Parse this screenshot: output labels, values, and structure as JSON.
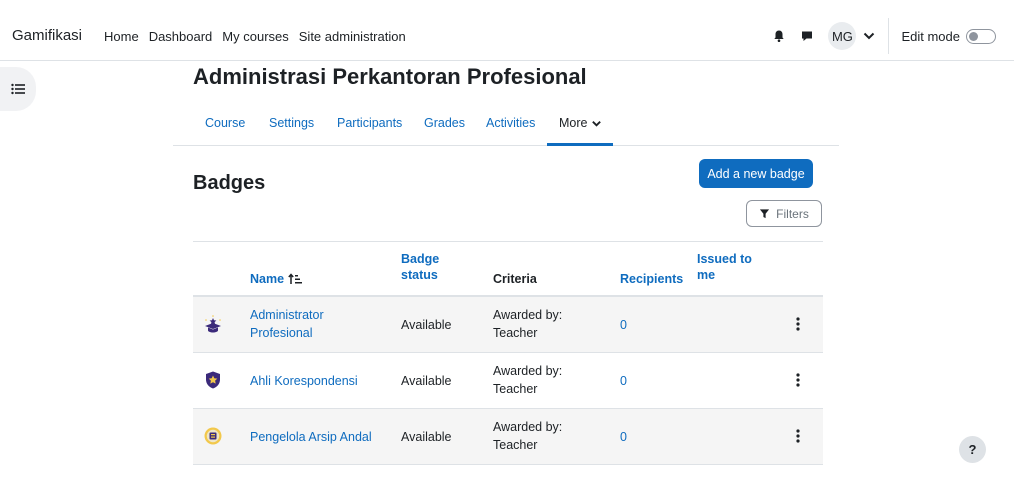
{
  "header": {
    "brand": "Gamifikasi",
    "nav": [
      "Home",
      "Dashboard",
      "My courses",
      "Site administration"
    ],
    "avatar_initials": "MG",
    "edit_mode_label": "Edit mode"
  },
  "course": {
    "title": "Administrasi Perkantoran Profesional",
    "tabs": [
      {
        "label": "Course",
        "active": false
      },
      {
        "label": "Settings",
        "active": false
      },
      {
        "label": "Participants",
        "active": false
      },
      {
        "label": "Grades",
        "active": false
      },
      {
        "label": "Activities",
        "active": false
      },
      {
        "label": "More",
        "active": true
      }
    ]
  },
  "page": {
    "heading": "Badges",
    "add_button": "Add a new badge",
    "filters_button": "Filters"
  },
  "table": {
    "headers": {
      "name": "Name",
      "status_line1": "Badge",
      "status_line2": "status",
      "criteria": "Criteria",
      "recipients": "Recipients",
      "issued_line1": "Issued to",
      "issued_line2": "me"
    },
    "rows": [
      {
        "name_line1": "Administrator",
        "name_line2": "Profesional",
        "status": "Available",
        "criteria_line1": "Awarded by:",
        "criteria_line2": "Teacher",
        "recipients": "0",
        "badge_icon": "graduation-star-badge-icon"
      },
      {
        "name_line1": "Ahli Korespondensi",
        "name_line2": "",
        "status": "Available",
        "criteria_line1": "Awarded by:",
        "criteria_line2": "Teacher",
        "recipients": "0",
        "badge_icon": "shield-star-badge-icon"
      },
      {
        "name_line1": "Pengelola Arsip Andal",
        "name_line2": "",
        "status": "Available",
        "criteria_line1": "Awarded by:",
        "criteria_line2": "Teacher",
        "recipients": "0",
        "badge_icon": "archive-medal-badge-icon"
      }
    ]
  },
  "help_label": "?",
  "colors": {
    "accent": "#0f6cbf",
    "text": "#1d2125",
    "badge_purple": "#3b2a7a",
    "badge_gold": "#f2c84b"
  }
}
